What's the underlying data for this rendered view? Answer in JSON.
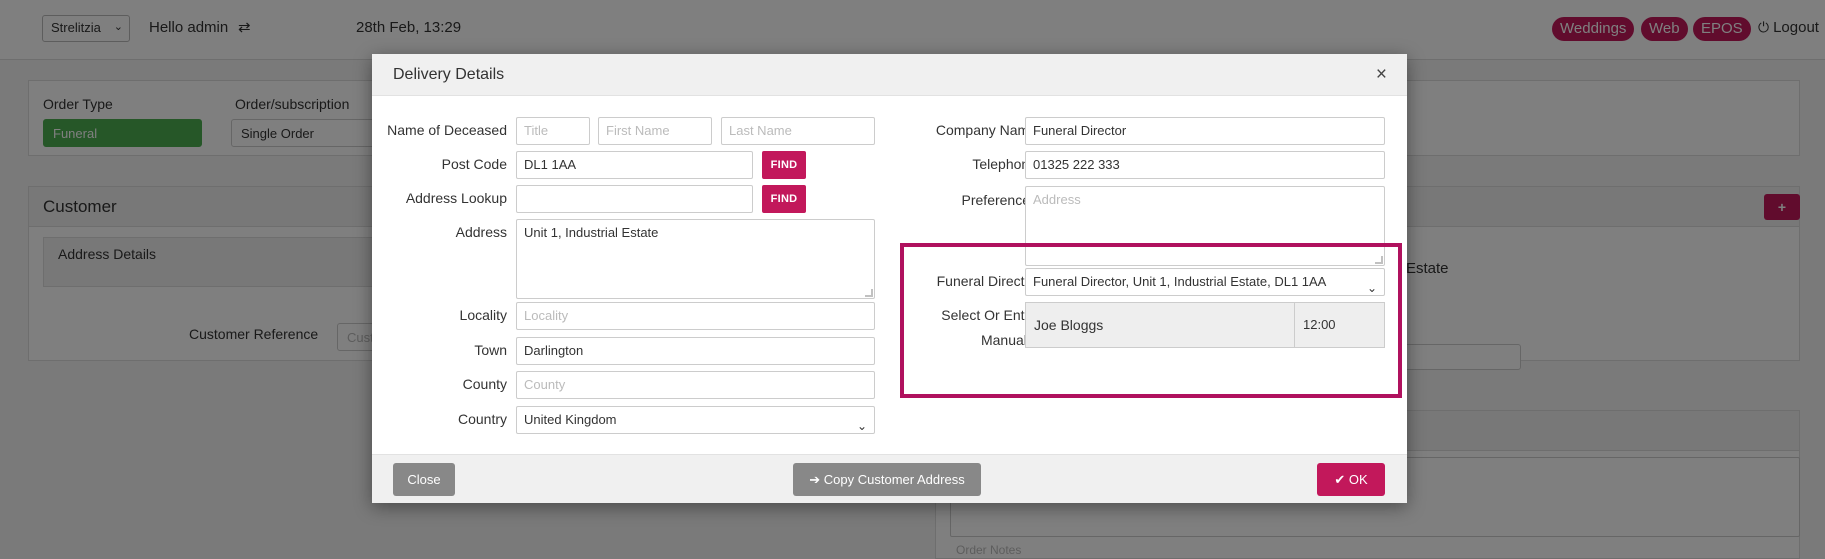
{
  "topbar": {
    "shop": "Strelitzia",
    "greeting": "Hello admin",
    "datetime": "28th Feb, 13:29",
    "pills": [
      "Weddings",
      "Web",
      "EPOS"
    ],
    "logout": "Logout"
  },
  "background": {
    "order_type_label": "Order Type",
    "order_type_value": "Funeral",
    "order_sub_label": "Order/subscription",
    "order_sub_value": "Single Order",
    "customer_heading": "Customer",
    "address_details": "Address Details",
    "customer_reference": "Customer Reference",
    "customer_reference_ph": "Cust",
    "estate_fragment": "Estate",
    "order_notes_ph": "Order Notes",
    "plus": "+"
  },
  "modal": {
    "title": "Delivery Details",
    "close_x": "×",
    "left": {
      "name_of_deceased_label": "Name of Deceased",
      "title_ph": "Title",
      "first_name_ph": "First Name",
      "last_name_ph": "Last Name",
      "post_code_label": "Post Code",
      "post_code_value": "DL1 1AA",
      "find": "FIND",
      "address_lookup_label": "Address Lookup",
      "address_lookup_value": "",
      "address_label": "Address",
      "address_value": "Unit 1, Industrial Estate",
      "locality_label": "Locality",
      "locality_ph": "Locality",
      "town_label": "Town",
      "town_value": "Darlington",
      "county_label": "County",
      "county_ph": "County",
      "country_label": "Country",
      "country_value": "United Kingdom"
    },
    "right": {
      "company_name_label": "Company Name",
      "company_name_value": "Funeral Director",
      "telephone_label": "Telephone",
      "telephone_value": "01325 222 333",
      "preferences_label": "Preferences",
      "preferences_ph": "Address",
      "funeral_director_label": "Funeral Director",
      "funeral_director_value": "Funeral Director, Unit 1, Industrial Estate, DL1 1AA",
      "select_manual_label_1": "Select Or Enter",
      "select_manual_label_2": "Manually",
      "manual_name": "Joe Bloggs",
      "manual_time": "12:00"
    },
    "footer": {
      "close": "Close",
      "copy_customer_address": "Copy Customer Address",
      "ok": "OK"
    }
  },
  "colors": {
    "accent": "#c2185b",
    "highlight": "#b0115e",
    "grey_button": "#888888"
  }
}
